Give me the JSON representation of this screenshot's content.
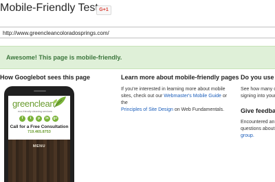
{
  "header": {
    "title": "Mobile-Friendly Test",
    "gplus_label": "G+1"
  },
  "url_input": {
    "value": "http://www.greencleancoloradosprings.com/"
  },
  "result_banner": {
    "text": "Awesome! This page is mobile-friendly.",
    "color": "#3c763d",
    "background": "#dff0d8"
  },
  "preview": {
    "heading": "How Googlebot sees this page",
    "site": {
      "logo_text": "greenclean",
      "tagline": "eco-friendly cleaning services",
      "social_icons": [
        "facebook-icon",
        "twitter-icon",
        "pinterest-icon",
        "linkedin-icon",
        "googleplus-icon"
      ],
      "social_glyphs": [
        "f",
        "t",
        "p",
        "in",
        "g+"
      ],
      "cta": "Call for a Free Consultation",
      "phone": "719.465.8753",
      "menu_label": "MENU"
    }
  },
  "learn_more": {
    "heading": "Learn more about mobile-friendly pages",
    "text_1": "If you're interested in learning more about mobile sites, check out our",
    "link_1": "Webmaster's Mobile Guide",
    "text_2": "or the",
    "link_2": "Principles of Site Design",
    "text_3": "on Web Fundamentals."
  },
  "right_column": {
    "heading_1": "Do you use C",
    "text_1": "See how many o signing into your",
    "heading_2": "Give feedba",
    "text_2": "Encountered an i questions about f",
    "link": "group."
  },
  "colors": {
    "accent": "#6a9c2f",
    "link": "#1a5dba"
  }
}
